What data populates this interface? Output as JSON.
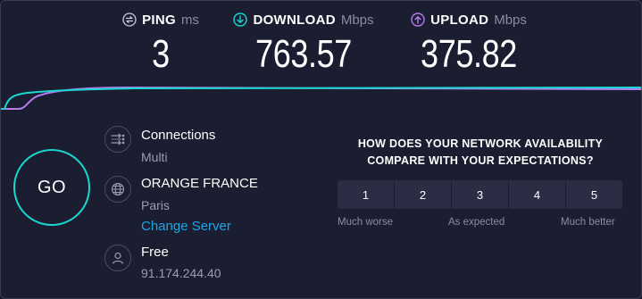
{
  "metrics": {
    "ping": {
      "label": "PING",
      "unit": "ms",
      "value": "3",
      "icon": "ping-icon",
      "color": "#c9cbe0"
    },
    "download": {
      "label": "DOWNLOAD",
      "unit": "Mbps",
      "value": "763.57",
      "icon": "download-arrow-icon",
      "color": "#1ad7d0"
    },
    "upload": {
      "label": "UPLOAD",
      "unit": "Mbps",
      "value": "375.82",
      "icon": "upload-arrow-icon",
      "color": "#b57cf2"
    }
  },
  "go_button": {
    "label": "GO",
    "color": "#1ad7d0"
  },
  "connections": {
    "title": "Connections",
    "value": "Multi",
    "icon": "connections-icon"
  },
  "server": {
    "provider": "ORANGE FRANCE",
    "city": "Paris",
    "change_label": "Change Server",
    "icon": "globe-icon"
  },
  "user": {
    "isp": "Free",
    "ip": "91.174.244.40",
    "icon": "user-icon"
  },
  "survey": {
    "question": "HOW DOES YOUR NETWORK AVAILABILITY COMPARE WITH YOUR EXPECTATIONS?",
    "options": [
      "1",
      "2",
      "3",
      "4",
      "5"
    ],
    "scale": {
      "low": "Much worse",
      "mid": "As expected",
      "high": "Much better"
    }
  },
  "colors": {
    "background": "#1b1d31",
    "accent_download": "#1ad7d0",
    "accent_upload": "#b57cf2",
    "link": "#1aa7e6"
  }
}
